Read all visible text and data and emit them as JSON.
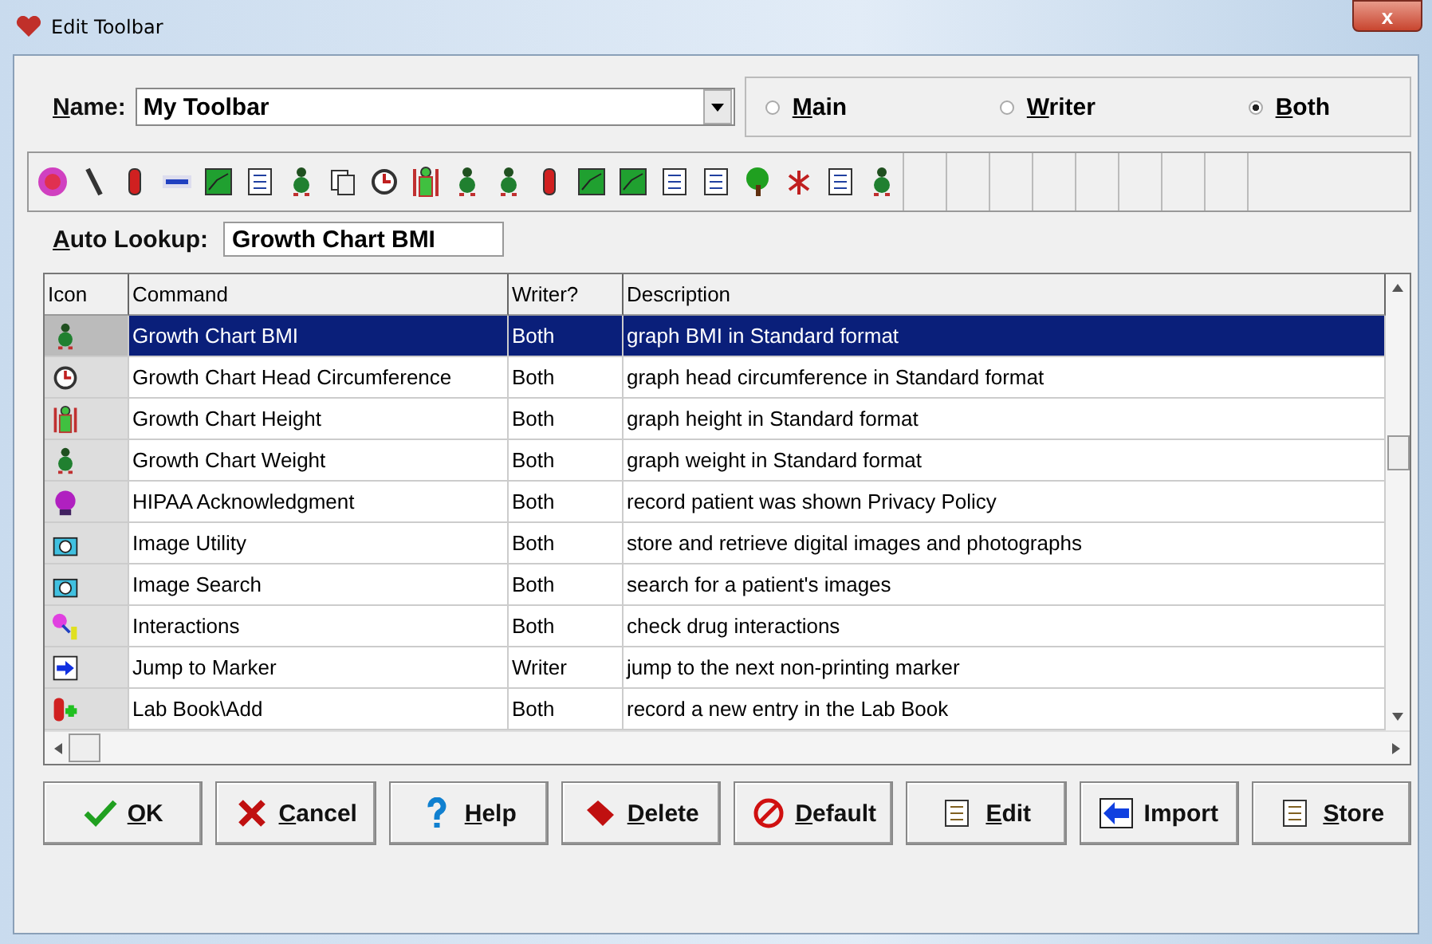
{
  "window": {
    "title": "Edit Toolbar",
    "close": "x"
  },
  "name_field": {
    "label": "Name:",
    "value": "My Toolbar"
  },
  "scope": [
    {
      "label": "Main",
      "selected": false
    },
    {
      "label": "Writer",
      "selected": false
    },
    {
      "label": "Both",
      "selected": true
    }
  ],
  "auto_lookup": {
    "label": "Auto Lookup:",
    "value": "Growth Chart BMI"
  },
  "table": {
    "columns": [
      "Icon",
      "Command",
      "Writer?",
      "Description"
    ],
    "rows": [
      {
        "command": "Growth Chart BMI",
        "writer": "Both",
        "description": "graph BMI in Standard format",
        "selected": true
      },
      {
        "command": "Growth Chart Head Circumference",
        "writer": "Both",
        "description": "graph head circumference in Standard format",
        "selected": false
      },
      {
        "command": "Growth Chart Height",
        "writer": "Both",
        "description": "graph height in Standard format",
        "selected": false
      },
      {
        "command": "Growth Chart Weight",
        "writer": "Both",
        "description": "graph weight in Standard format",
        "selected": false
      },
      {
        "command": "HIPAA Acknowledgment",
        "writer": "Both",
        "description": "record patient was shown Privacy Policy",
        "selected": false
      },
      {
        "command": "Image Utility",
        "writer": "Both",
        "description": "store and retrieve digital images and photographs",
        "selected": false
      },
      {
        "command": "Image Search",
        "writer": "Both",
        "description": "search for a patient's images",
        "selected": false
      },
      {
        "command": "Interactions",
        "writer": "Both",
        "description": "check drug interactions",
        "selected": false
      },
      {
        "command": "Jump to Marker",
        "writer": "Writer",
        "description": "jump to the next non-printing marker",
        "selected": false
      },
      {
        "command": "Lab Book\\Add",
        "writer": "Both",
        "description": "record a new entry in the Lab Book",
        "selected": false
      }
    ]
  },
  "buttons": [
    {
      "kind": "ok",
      "label": "OK"
    },
    {
      "kind": "cancel",
      "label": "Cancel"
    },
    {
      "kind": "help",
      "label": "Help"
    },
    {
      "kind": "delete",
      "label": "Delete"
    },
    {
      "kind": "default",
      "label": "Default"
    },
    {
      "kind": "edit",
      "label": "Edit"
    },
    {
      "kind": "import",
      "label": "Import"
    },
    {
      "kind": "store",
      "label": "Store"
    }
  ]
}
